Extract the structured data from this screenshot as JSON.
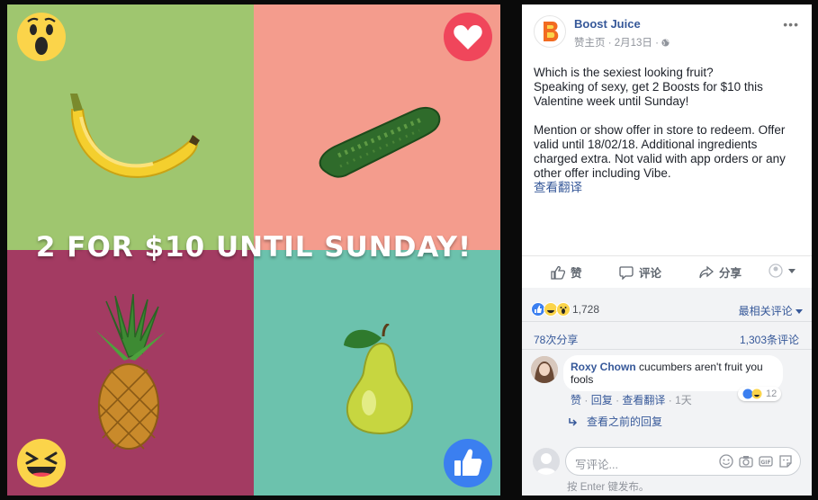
{
  "colors": {
    "top_left": "#9fc66f",
    "top_right": "#f49c8d",
    "bottom_left": "#a33b62",
    "bottom_right": "#6cc2ad",
    "link": "#365899"
  },
  "image": {
    "promo_text": "2 FOR $10 UNTIL SUNDAY!",
    "fruits": [
      "banana",
      "cucumber",
      "pineapple",
      "pear"
    ],
    "reactions": [
      "wow-icon",
      "love-icon",
      "haha-icon",
      "like-icon"
    ]
  },
  "post": {
    "page_name": "Boost Juice",
    "meta_page": "赞主页",
    "meta_date": "2月13日",
    "meta_sep": "·",
    "more_label": "•••",
    "text_lines_1": [
      "Which is the sexiest looking fruit?",
      "Speaking of sexy, get 2 Boosts for $10 this Valentine week until Sunday!"
    ],
    "text_lines_2": "Mention or show offer in store to redeem. Offer valid until 18/02/18. Additional ingredients charged extra. Not valid with app orders or any other offer including Vibe.",
    "translate": "查看翻译"
  },
  "actions": {
    "like": "赞",
    "comment": "评论",
    "share": "分享"
  },
  "stats": {
    "reaction_count": "1,728",
    "rank": "最相关评论",
    "shares": "78次分享",
    "comments": "1,303条评论"
  },
  "comment": {
    "author": "Roxy Chown",
    "text": "cucumbers aren't fruit you fools",
    "reaction_count": "12",
    "like": "赞",
    "reply": "回复",
    "translate": "查看翻译",
    "sep": "·",
    "time": "1天",
    "previous_replies": "查看之前的回复"
  },
  "composer": {
    "placeholder": "写评论...",
    "hint": "按 Enter 键发布。"
  }
}
